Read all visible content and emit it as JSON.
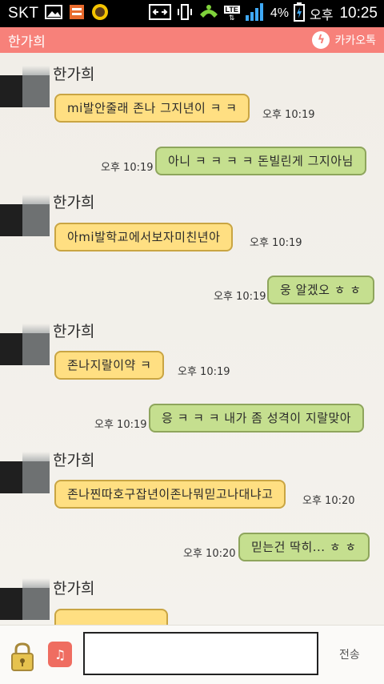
{
  "status_bar": {
    "carrier": "SKT",
    "battery_percent": "4%",
    "ampm": "오후",
    "time": "10:25",
    "lte": "LTE"
  },
  "title_bar": {
    "title": "한가희",
    "brand": "카카오톡"
  },
  "messages": [
    {
      "dir": "in",
      "sender": "한가희",
      "text": "mi발안줄래 존나 그지년이 ㅋ ㅋ",
      "time": "오후 10:19"
    },
    {
      "dir": "out",
      "text": "아니 ㅋ ㅋ ㅋ ㅋ 돈빌린게 그지아님",
      "time": "오후 10:19"
    },
    {
      "dir": "in",
      "sender": "한가희",
      "text": "아mi발학교에서보자미친년아",
      "time": "오후 10:19"
    },
    {
      "dir": "out",
      "text": "웅 알겠오 ㅎ ㅎ",
      "time": "오후 10:19"
    },
    {
      "dir": "in",
      "sender": "한가희",
      "text": "존나지랄이약 ㅋ",
      "time": "오후 10:19"
    },
    {
      "dir": "out",
      "text": "응 ㅋ ㅋ ㅋ 내가 좀 성격이 지랄맞아",
      "time": "오후 10:19"
    },
    {
      "dir": "in",
      "sender": "한가희",
      "text": "존나찐따호구잡년이존나뭐믿고나대냐고",
      "time": "오후 10:20"
    },
    {
      "dir": "out",
      "text": "믿는건 딱히... ㅎ ㅎ",
      "time": "오후 10:20"
    },
    {
      "dir": "in",
      "sender": "한가희"
    }
  ],
  "input_bar": {
    "send_label": "전송"
  },
  "colors": {
    "title_bg": "#f7817a",
    "in_bubble": "#ffdf82",
    "out_bubble": "#c5df8f"
  }
}
